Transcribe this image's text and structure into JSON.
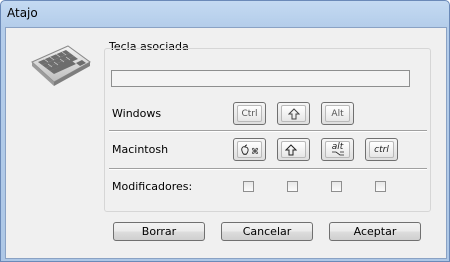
{
  "window": {
    "title": "Atajo"
  },
  "group": {
    "title": "Tecla asociada",
    "shortcut_value": ""
  },
  "rows": {
    "windows": {
      "label": "Windows",
      "keys": [
        "Ctrl",
        "⇧",
        "Alt"
      ]
    },
    "macintosh": {
      "label": "Macintosh",
      "keys": [
        "⌘",
        "⇧",
        "alt",
        "ctrl"
      ]
    },
    "modifiers": {
      "label": "Modificadores:",
      "checked": [
        false,
        false,
        false,
        false
      ]
    }
  },
  "buttons": {
    "clear": "Borrar",
    "cancel": "Cancelar",
    "accept": "Aceptar"
  },
  "colors": {
    "title_bar": "#b9d1ea",
    "dialog_bg": "#f0f0f0",
    "border": "#6b8ab8"
  }
}
